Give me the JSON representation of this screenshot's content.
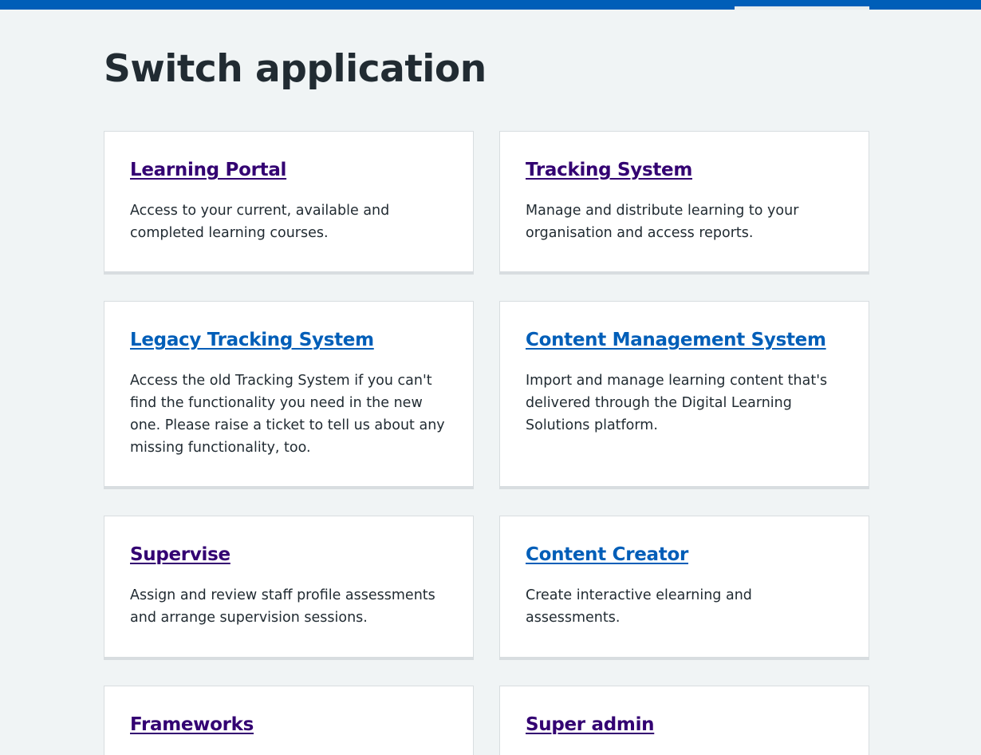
{
  "page": {
    "title": "Switch application"
  },
  "colors": {
    "header_blue": "#005eb8",
    "visited_link": "#330072",
    "link": "#005eb8",
    "background": "#f0f4f5",
    "card_border": "#d8dde0"
  },
  "cards": [
    {
      "title": "Learning Portal",
      "description": "Access to your current, available and completed learning courses.",
      "link_state": "visited"
    },
    {
      "title": "Tracking System",
      "description": "Manage and distribute learning to your organisation and access reports.",
      "link_state": "visited"
    },
    {
      "title": "Legacy Tracking System",
      "description": "Access the old Tracking System if you can't find the functionality you need in the new one. Please raise a ticket to tell us about any missing functionality, too.",
      "link_state": "unvisited"
    },
    {
      "title": "Content Management System",
      "description": "Import and manage learning content that's delivered through the Digital Learning Solutions platform.",
      "link_state": "unvisited"
    },
    {
      "title": "Supervise",
      "description": "Assign and review staff profile assessments and arrange supervision sessions.",
      "link_state": "visited"
    },
    {
      "title": "Content Creator",
      "description": "Create interactive elearning and assessments.",
      "link_state": "unvisited"
    },
    {
      "title": "Frameworks",
      "description": "",
      "link_state": "visited"
    },
    {
      "title": "Super admin",
      "description": "",
      "link_state": "visited"
    }
  ]
}
